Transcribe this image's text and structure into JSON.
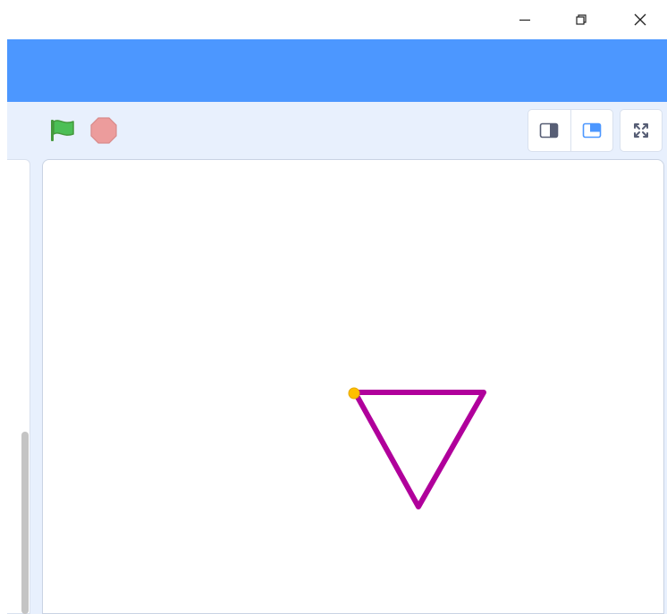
{
  "window_controls": {
    "minimize_icon": "minimize-icon",
    "maximize_icon": "restore-icon",
    "close_icon": "close-icon"
  },
  "colors": {
    "menubar": "#4c97ff",
    "stage_header": "#e8f0fd",
    "pen": "#b0009b",
    "sprite_dot": "#ffbf00",
    "flag_green": "#4cbf56",
    "stop_red": "#ec9c9c"
  },
  "stage_controls": {
    "green_flag_icon": "green-flag-icon",
    "stop_icon": "stop-sign-icon",
    "small_stage_icon": "small-stage-icon",
    "large_stage_icon": "large-stage-icon",
    "fullscreen_icon": "fullscreen-icon"
  },
  "drawing": {
    "shape": "downward triangle",
    "sprite": "pen-sprite-dot"
  }
}
